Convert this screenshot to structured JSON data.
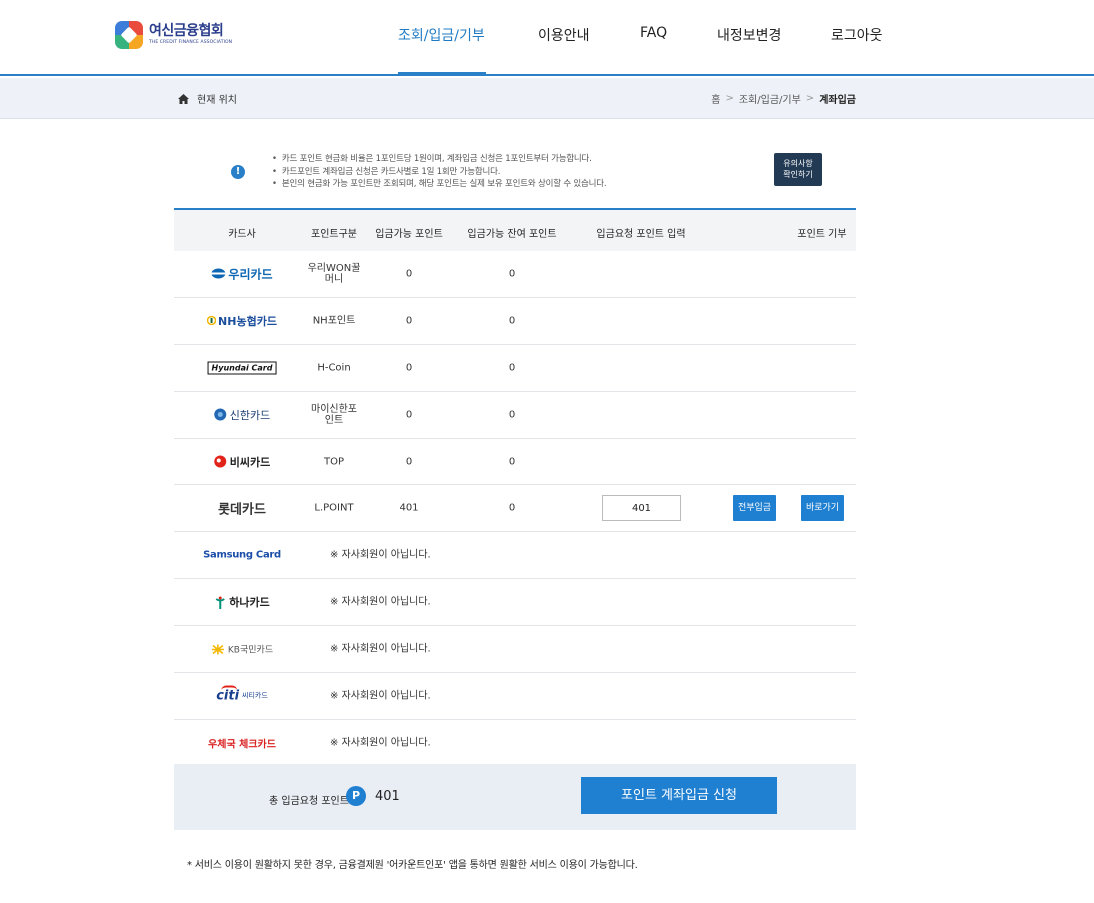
{
  "header": {
    "logo_kr": "여신금융협회",
    "logo_en": "THE CREDIT FINANCE ASSOCIATION",
    "nav": [
      {
        "label": "조회/입금/기부",
        "active": true
      },
      {
        "label": "이용안내",
        "active": false
      },
      {
        "label": "FAQ",
        "active": false
      },
      {
        "label": "내정보변경",
        "active": false
      },
      {
        "label": "로그아웃",
        "active": false
      }
    ]
  },
  "location": {
    "label": "현재 위치",
    "crumbs": [
      "홈",
      "조회/입금/기부",
      "계좌입금"
    ],
    "separator": ">"
  },
  "notice": {
    "icon": "info-icon",
    "items": [
      "카드 포인트 현금화 비율은 1포인트당 1원이며, 계좌입금 신청은 1포인트부터 가능합니다.",
      "카드포인트 계좌입금 신청은 카드사별로 1일 1회만 가능합니다.",
      "본인의 현금화 가능 포인트만 조회되며, 해당 포인트는 실제 보유 포인트와 상이할 수 있습니다."
    ],
    "button_line1": "유의사항",
    "button_line2": "확인하기"
  },
  "table": {
    "headers": [
      "카드사",
      "포인트구분",
      "입금가능 포인트",
      "입금가능 잔여 포인트",
      "입금요청 포인트 입력",
      "포인트 기부"
    ],
    "rows": [
      {
        "card": "우리카드",
        "type": "우리WON꿀머니",
        "available": "0",
        "remaining": "0"
      },
      {
        "card": "NH농협카드",
        "type": "NH포인트",
        "available": "0",
        "remaining": "0"
      },
      {
        "card": "Hyundai Card",
        "type": "H-Coin",
        "available": "0",
        "remaining": "0"
      },
      {
        "card": "신한카드",
        "type": "마이신한포인트",
        "available": "0",
        "remaining": "0"
      },
      {
        "card": "비씨카드",
        "type": "TOP",
        "available": "0",
        "remaining": "0"
      },
      {
        "card": "롯데카드",
        "type": "L.POINT",
        "available": "401",
        "remaining": "0",
        "input": "401",
        "btn_all": "전부입금",
        "btn_go": "바로가기"
      },
      {
        "card": "Samsung Card",
        "msg": "※ 자사회원이 아닙니다."
      },
      {
        "card": "하나카드",
        "msg": "※ 자사회원이 아닙니다."
      },
      {
        "card": "KB국민카드",
        "msg": "※ 자사회원이 아닙니다."
      },
      {
        "card": "씨티카드",
        "msg": "※ 자사회원이 아닙니다."
      },
      {
        "card": "우체국 체크카드",
        "msg": "※ 자사회원이 아닙니다."
      }
    ]
  },
  "summary": {
    "label": "총 입금요청 포인트",
    "badge": "P",
    "value": "401",
    "submit": "포인트 계좌입금 신청"
  },
  "footnote": "* 서비스 이용이 원활하지 못한 경우, 금융결제원 '어카운트인포' 앱을 통하면 원활한 서비스 이용이 가능합니다.",
  "colors": {
    "accent": "#1f7fd0",
    "nav_active": "#1f7bc4",
    "dark_button": "#233a55"
  }
}
